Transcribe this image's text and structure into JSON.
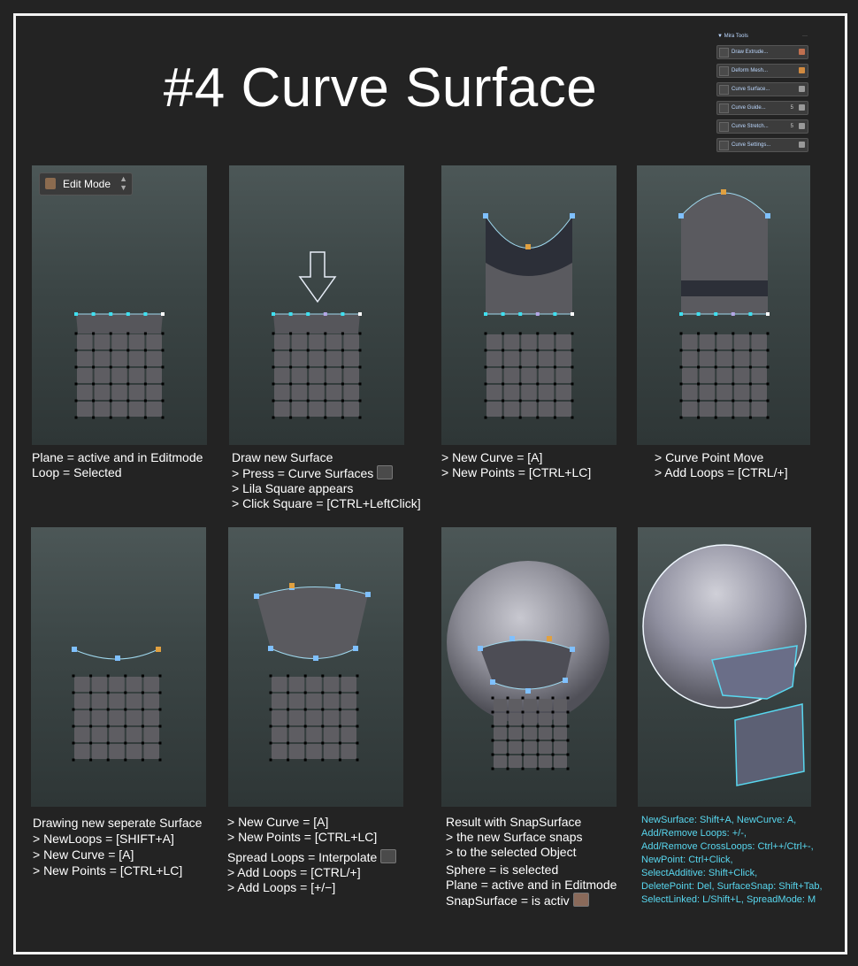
{
  "title": "#4 Curve Surface",
  "mira_tools": {
    "header": "▼ Mira Tools",
    "menu": "···",
    "rows": [
      {
        "label": "Draw Extrude...",
        "icon": "pencil-icon"
      },
      {
        "label": "Deform Mesh...",
        "icon": "deform-icon"
      },
      {
        "label": "Curve Surface...",
        "icon": "surface-icon"
      },
      {
        "label": "Curve Guide...",
        "icon": "guide-icon",
        "value": "5"
      },
      {
        "label": "Curve Stretch...",
        "icon": "stretch-icon",
        "value": "5"
      },
      {
        "label": "Curve Settings...",
        "icon": "settings-icon"
      }
    ]
  },
  "edit_mode_label": "Edit Mode",
  "captions": {
    "p1": [
      "Plane = active and in Editmode",
      "Loop = Selected"
    ],
    "p2": [
      "Draw new Surface",
      "> Press = Curve Surfaces",
      "> Lila Square appears",
      "> Click Square = [CTRL+LeftClick]"
    ],
    "p3": [
      "> New Curve = [A]",
      "> New Points = [CTRL+LC]"
    ],
    "p4": [
      "> Curve Point Move",
      "> Add Loops = [CTRL/+]"
    ],
    "p5": [
      "Drawing new seperate Surface",
      "> NewLoops = [SHIFT+A]",
      "> New Curve = [A]",
      "> New Points = [CTRL+LC]"
    ],
    "p6a": [
      "> New Curve = [A]",
      "> New Points = [CTRL+LC]"
    ],
    "p6b": [
      "Spread Loops = Interpolate",
      "> Add Loops = [CTRL/+]",
      "> Add Loops = [+/−]"
    ],
    "p7a": [
      "Result with SnapSurface",
      "> the new Surface snaps",
      "> to the selected Object"
    ],
    "p7b": [
      "Sphere = is selected",
      "Plane = active and in Editmode",
      "SnapSurface = is  activ"
    ],
    "p8": [
      "NewSurface: Shift+A, NewCurve: A,",
      "Add/Remove Loops: +/-,",
      "Add/Remove CrossLoops: Ctrl++/Ctrl+-,",
      "NewPoint: Ctrl+Click,",
      "SelectAdditive: Shift+Click,",
      "DeletePoint: Del, SurfaceSnap: Shift+Tab,",
      "SelectLinked: L/Shift+L, SpreadMode: M"
    ]
  },
  "colors": {
    "background": "#232323",
    "accent_cyan": "#58d7ef",
    "lila": "#b3a6e6",
    "orange_point": "#e0a040",
    "face": "#5e5d62"
  }
}
